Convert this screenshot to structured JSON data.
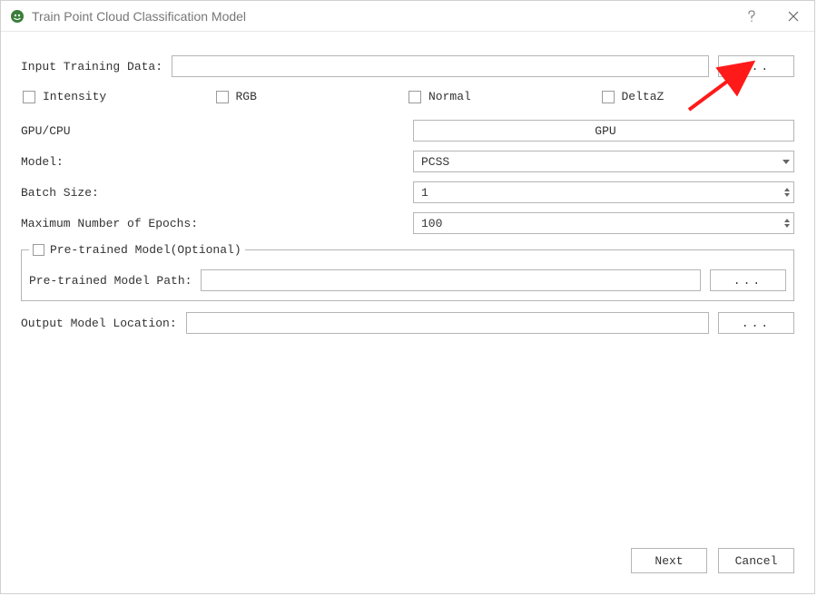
{
  "window": {
    "title": "Train Point Cloud Classification Model"
  },
  "labels": {
    "input_training": "Input Training Data:",
    "intensity": "Intensity",
    "rgb": "RGB",
    "normal": "Normal",
    "deltaz": "DeltaZ",
    "gpu_cpu": "GPU/CPU",
    "model": "Model:",
    "batch_size": "Batch Size:",
    "max_epochs": "Maximum Number of Epochs:",
    "pretrained_group": "Pre-trained Model(Optional)",
    "pretrained_path": "Pre-trained Model Path:",
    "output_location": "Output Model Location:",
    "browse": "...",
    "next": "Next",
    "cancel": "Cancel"
  },
  "values": {
    "input_training": "",
    "gpu_cpu": "GPU",
    "model": "PCSS",
    "batch_size": "1",
    "max_epochs": "100",
    "pretrained_path": "",
    "output_location": ""
  }
}
